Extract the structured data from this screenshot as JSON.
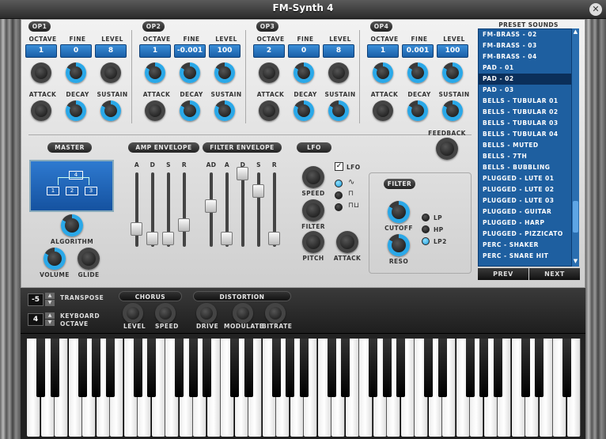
{
  "window": {
    "title": "FM-Synth 4",
    "close": "✕"
  },
  "operators": [
    {
      "name": "OP1",
      "octave": "1",
      "fine": "0",
      "level": "8"
    },
    {
      "name": "OP2",
      "octave": "1",
      "fine": "-0.001",
      "level": "100"
    },
    {
      "name": "OP3",
      "octave": "2",
      "fine": "0",
      "level": "8"
    },
    {
      "name": "OP4",
      "octave": "1",
      "fine": "0.001",
      "level": "100"
    }
  ],
  "op_labels": {
    "octave": "OCTAVE",
    "fine": "FINE",
    "level": "LEVEL",
    "attack": "ATTACK",
    "decay": "DECAY",
    "sustain": "SUSTAIN"
  },
  "feedback": "FEEDBACK",
  "master": {
    "title": "MASTER",
    "algorithm": "ALGORITHM",
    "volume": "VOLUME",
    "glide": "GLIDE",
    "algo_boxes": [
      "4",
      "1",
      "2",
      "3"
    ]
  },
  "amp_envelope": {
    "title": "AMP ENVELOPE",
    "labels": [
      "A",
      "D",
      "S",
      "R"
    ]
  },
  "filter_envelope": {
    "title": "FILTER ENVELOPE",
    "labels": [
      "AD",
      "A",
      "D",
      "S",
      "R"
    ]
  },
  "lfo": {
    "title": "LFO",
    "speed": "SPEED",
    "filter": "FILTER",
    "pitch": "PITCH",
    "attack": "ATTACK",
    "toggle": "LFO",
    "waves": [
      "∿",
      "⊓",
      "⊓⊔"
    ]
  },
  "filter": {
    "title": "FILTER",
    "cutoff": "CUTOFF",
    "reso": "RESO",
    "modes": [
      "LP",
      "HP",
      "LP2"
    ]
  },
  "presets": {
    "title": "PRESET SOUNDS",
    "items": [
      "FM-BRASS - 02",
      "FM-BRASS - 03",
      "FM-BRASS - 04",
      "PAD - 01",
      "PAD - 02",
      "PAD - 03",
      "BELLS - TUBULAR 01",
      "BELLS - TUBULAR 02",
      "BELLS - TUBULAR 03",
      "BELLS - TUBULAR 04",
      "BELLS - MUTED",
      "BELLS - 7TH",
      "BELLS - BUBBLING",
      "PLUGGED - LUTE 01",
      "PLUGGED - LUTE 02",
      "PLUGGED - LUTE 03",
      "PLUGGED - GUITAR",
      "PLUGGED - HARP",
      "PLUGGED - PIZZICATO",
      "PERC - SHAKER",
      "PERC - SNARE HIT"
    ],
    "selected": "PAD - 02",
    "prev": "PREV",
    "next": "NEXT"
  },
  "bottom": {
    "transpose_value": "-5",
    "transpose": "TRANSPOSE",
    "octave_value": "4",
    "keyboard": "KEYBOARD",
    "octave": "OCTAVE",
    "chorus": "CHORUS",
    "chorus_level": "LEVEL",
    "chorus_speed": "SPEED",
    "distortion": "DISTORTION",
    "drive": "DRIVE",
    "modulate": "MODULATE",
    "bitrate": "BITRATE"
  }
}
